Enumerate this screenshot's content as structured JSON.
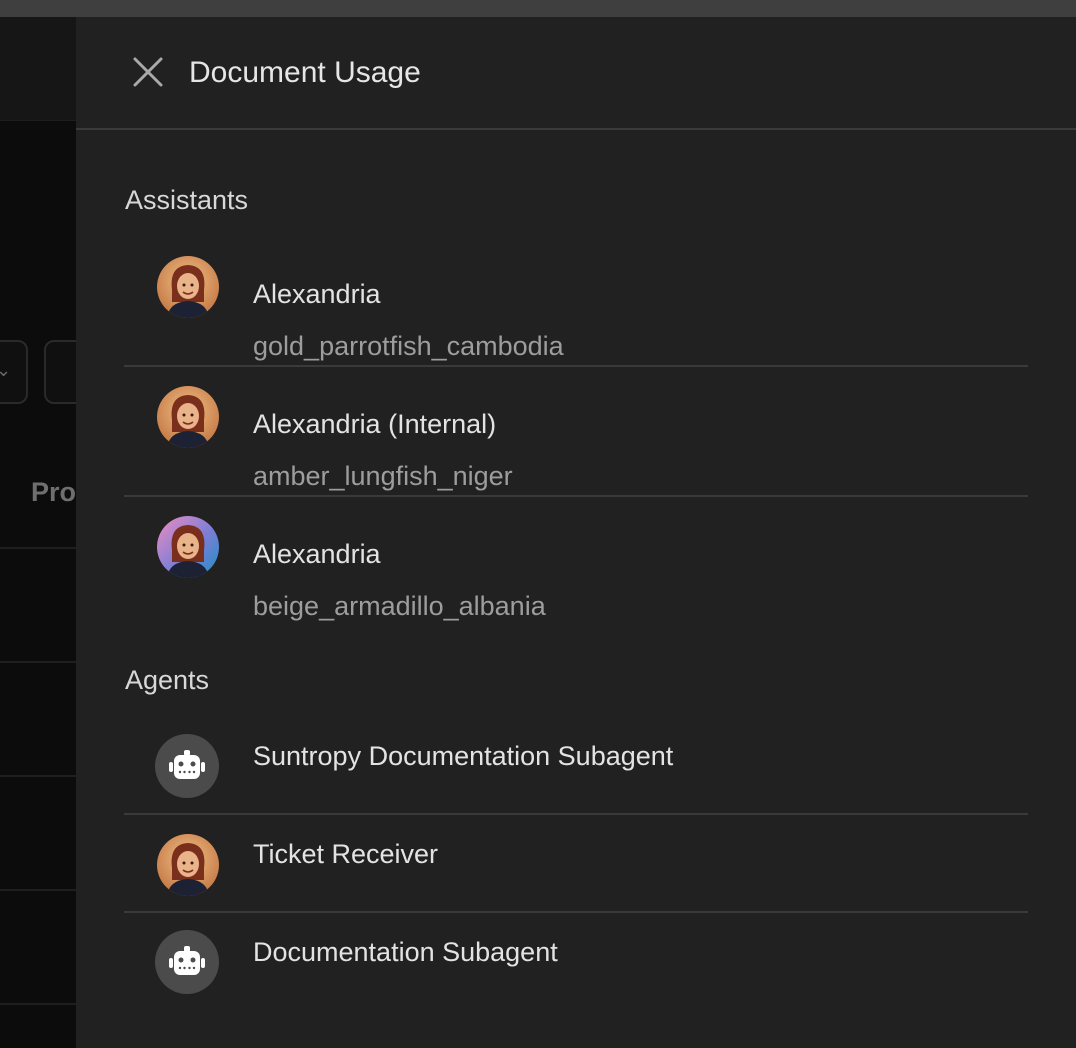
{
  "drawer": {
    "title": "Document Usage"
  },
  "background": {
    "column_header": "Pro"
  },
  "sections": {
    "assistants": {
      "title": "Assistants",
      "items": [
        {
          "name": "Alexandria",
          "id": "gold_parrotfish_cambodia",
          "icon": "avatar-orange"
        },
        {
          "name": "Alexandria (Internal)",
          "id": "amber_lungfish_niger",
          "icon": "avatar-orange"
        },
        {
          "name": "Alexandria",
          "id": "beige_armadillo_albania",
          "icon": "avatar-pink-blue"
        }
      ]
    },
    "agents": {
      "title": "Agents",
      "items": [
        {
          "name": "Suntropy Documentation Subagent",
          "icon": "robot-icon"
        },
        {
          "name": "Ticket Receiver",
          "icon": "avatar-orange"
        },
        {
          "name": "Documentation Subagent",
          "icon": "robot-icon"
        }
      ]
    }
  },
  "colors": {
    "drawer_bg": "#212121",
    "divider": "#3a3a3a",
    "text_primary": "#e3e3e3",
    "text_secondary": "#9d9d9d"
  }
}
